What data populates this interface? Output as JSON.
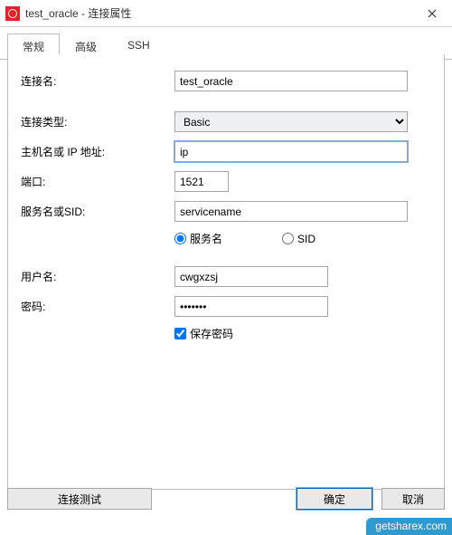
{
  "window": {
    "title": "test_oracle - 连接属性"
  },
  "tabs": {
    "general": "常规",
    "advanced": "高级",
    "ssh": "SSH"
  },
  "labels": {
    "conn_name": "连接名:",
    "conn_type": "连接类型:",
    "host": "主机名或 IP 地址:",
    "port": "端口:",
    "service_sid": "服务名或SID:",
    "service": "服务名",
    "sid": "SID",
    "user": "用户名:",
    "password": "密码:",
    "save_pw": "保存密码"
  },
  "values": {
    "conn_name": "test_oracle",
    "conn_type": "Basic",
    "host": "ip",
    "port": "1521",
    "service": "servicename",
    "user": "cwgxzsj",
    "password": "•••••••"
  },
  "buttons": {
    "test": "连接测试",
    "ok": "确定",
    "cancel": "取消"
  },
  "watermark": "getsharex.com"
}
